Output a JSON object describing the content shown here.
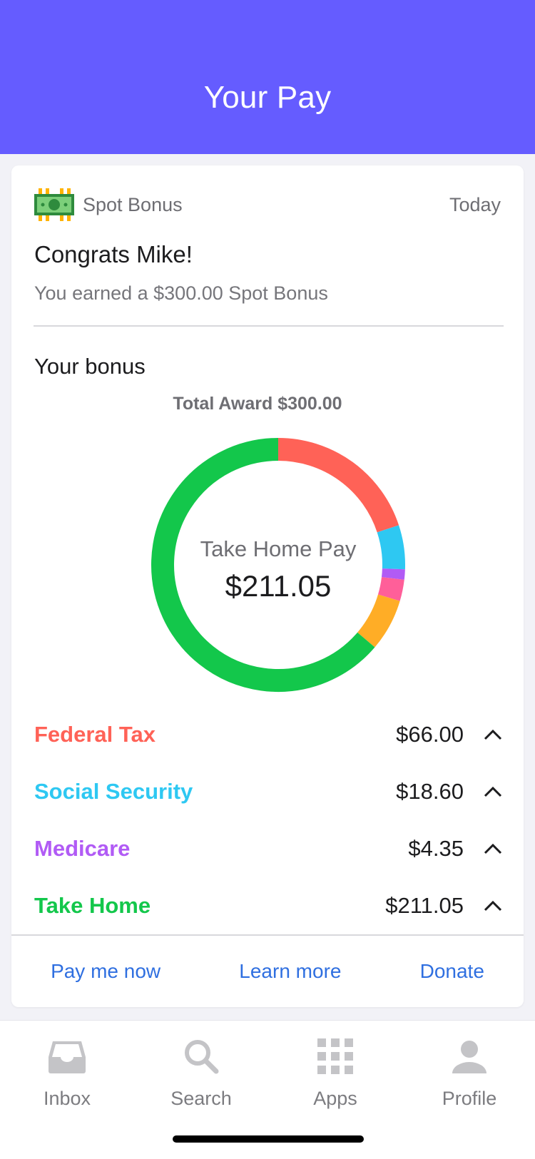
{
  "header": {
    "title": "Your Pay"
  },
  "card": {
    "icon": "money-bill-icon",
    "label": "Spot Bonus",
    "date": "Today",
    "congrats": "Congrats Mike!",
    "earned": "You earned a $300.00 Spot Bonus",
    "section_title": "Your bonus",
    "total_award": "Total Award $300.00",
    "center_label": "Take Home Pay",
    "center_value": "$211.05"
  },
  "chart_data": {
    "type": "pie",
    "variant": "donut",
    "total": 300.0,
    "slices": [
      {
        "name": "Federal Tax",
        "value": 66.0,
        "color": "#ff6257"
      },
      {
        "name": "Social Security",
        "value": 18.6,
        "color": "#2ec8f2"
      },
      {
        "name": "Medicare",
        "value": 4.35,
        "color": "#b15bf5"
      },
      {
        "name": "",
        "value": 9.0,
        "color": "#ff5f99"
      },
      {
        "name": "",
        "value": 22.0,
        "color": "#ffad26"
      },
      {
        "name": "Take Home",
        "value": 211.05,
        "color": "#13c74b"
      }
    ]
  },
  "breakdown": [
    {
      "label": "Federal Tax",
      "amount": "$66.00",
      "color": "#ff6257"
    },
    {
      "label": "Social Security",
      "amount": "$18.60",
      "color": "#2ec8f2"
    },
    {
      "label": "Medicare",
      "amount": "$4.35",
      "color": "#b15bf5"
    },
    {
      "label": "Take Home",
      "amount": "$211.05",
      "color": "#13c74b"
    }
  ],
  "actions": {
    "pay_now": "Pay me now",
    "learn_more": "Learn more",
    "donate": "Donate"
  },
  "tabs": [
    {
      "label": "Inbox",
      "icon": "inbox-icon"
    },
    {
      "label": "Search",
      "icon": "search-icon"
    },
    {
      "label": "Apps",
      "icon": "apps-grid-icon"
    },
    {
      "label": "Profile",
      "icon": "profile-icon"
    }
  ],
  "colors": {
    "accent": "#655cff",
    "link": "#2f6fe0"
  }
}
